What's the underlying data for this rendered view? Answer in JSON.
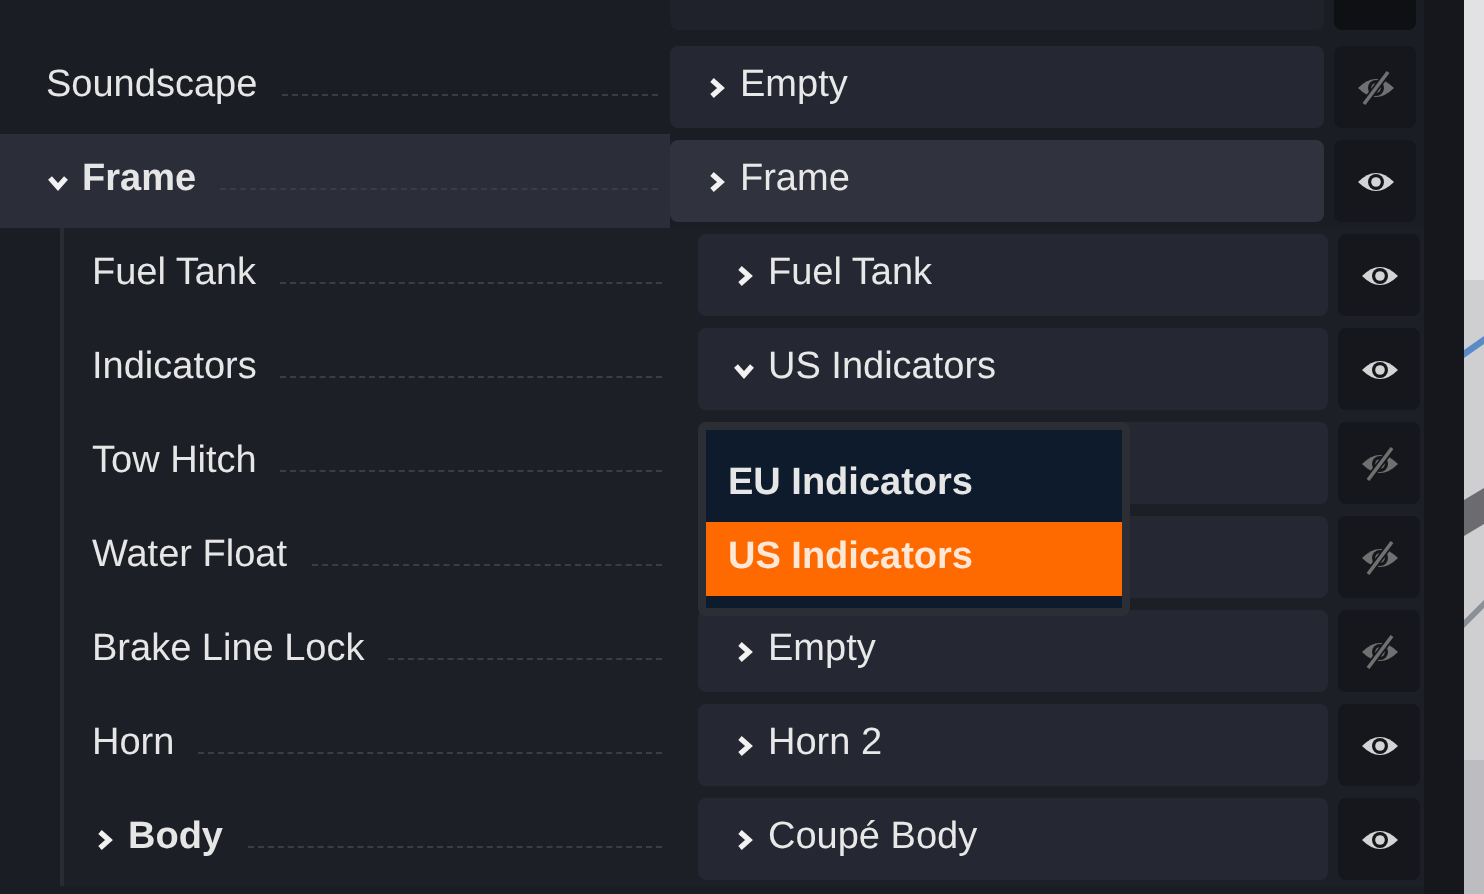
{
  "tree": [
    {
      "label": "Soundscape",
      "value": "Empty",
      "value_expanded": false,
      "visible": false,
      "selected": false
    },
    {
      "label": "Frame",
      "expanded": true,
      "value": "Frame",
      "value_expanded": false,
      "visible": true,
      "selected": true,
      "children": [
        {
          "label": "Fuel Tank",
          "value": "Fuel Tank",
          "value_expanded": false,
          "visible": true,
          "selected": false
        },
        {
          "label": "Indicators",
          "value": "US Indicators",
          "value_expanded": true,
          "visible": true,
          "selected": false,
          "dropdown": {
            "options": [
              {
                "label": "EU Indicators",
                "selected": false
              },
              {
                "label": "US Indicators",
                "selected": true
              }
            ]
          }
        },
        {
          "label": "Tow Hitch",
          "visible": false,
          "selected": false
        },
        {
          "label": "Water Float",
          "visible": false,
          "selected": false
        },
        {
          "label": "Brake Line Lock",
          "value": "Empty",
          "value_expanded": false,
          "visible": false,
          "selected": false
        },
        {
          "label": "Horn",
          "value": "Horn 2",
          "value_expanded": false,
          "visible": true,
          "selected": false
        },
        {
          "label": "Body",
          "expanded": false,
          "value": "Coupé Body",
          "value_expanded": false,
          "visible": true,
          "selected": false
        }
      ]
    }
  ]
}
